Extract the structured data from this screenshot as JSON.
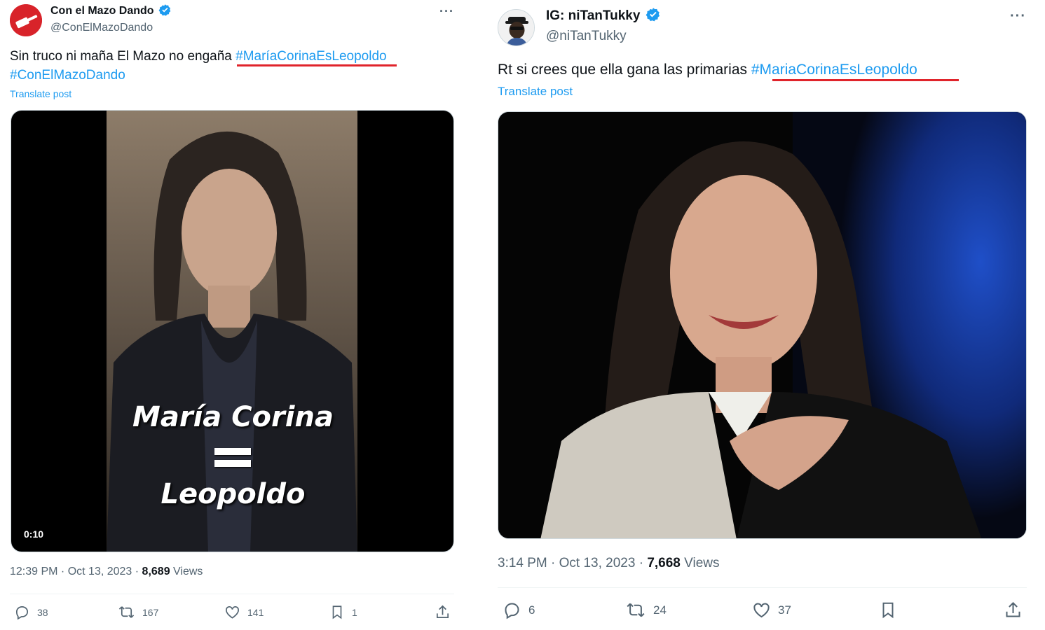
{
  "left": {
    "display_name": "Con el Mazo Dando",
    "handle": "@ConElMazoDando",
    "text_plain": "Sin truco ni maña El Mazo no engaña ",
    "hashtag1": "#MaríaCorinaEsLeopoldo",
    "hashtag2": "#ConElMazoDando",
    "translate": "Translate post",
    "video_overlay_line1": "María Corina",
    "video_overlay_line2": "Leopoldo",
    "video_duration": "0:10",
    "time_date": "12:39 PM · Oct 13, 2023 · ",
    "views_count": "8,689",
    "views_label": " Views",
    "replies": "38",
    "reposts": "167",
    "likes": "141",
    "bookmarks": "1"
  },
  "right": {
    "display_name": "IG: niTanTukky",
    "handle": "@niTanTukky",
    "text_plain": "Rt si crees que ella gana las primarias ",
    "hashtag1": "#MariaCorinaEsLeopoldo",
    "translate": "Translate post",
    "time_date": "3:14 PM · Oct 13, 2023 · ",
    "views_count": "7,668",
    "views_label": " Views",
    "replies": "6",
    "reposts": "24",
    "likes": "37"
  },
  "colors": {
    "link": "#1d9bf0",
    "secondary": "#536471",
    "primary_text": "#0f1419",
    "annotation_underline": "#e0242b",
    "verified": "#1d9bf0"
  },
  "icons": [
    "verified-badge-icon",
    "more-icon",
    "reply-icon",
    "repost-icon",
    "like-icon",
    "bookmark-icon",
    "share-icon"
  ]
}
